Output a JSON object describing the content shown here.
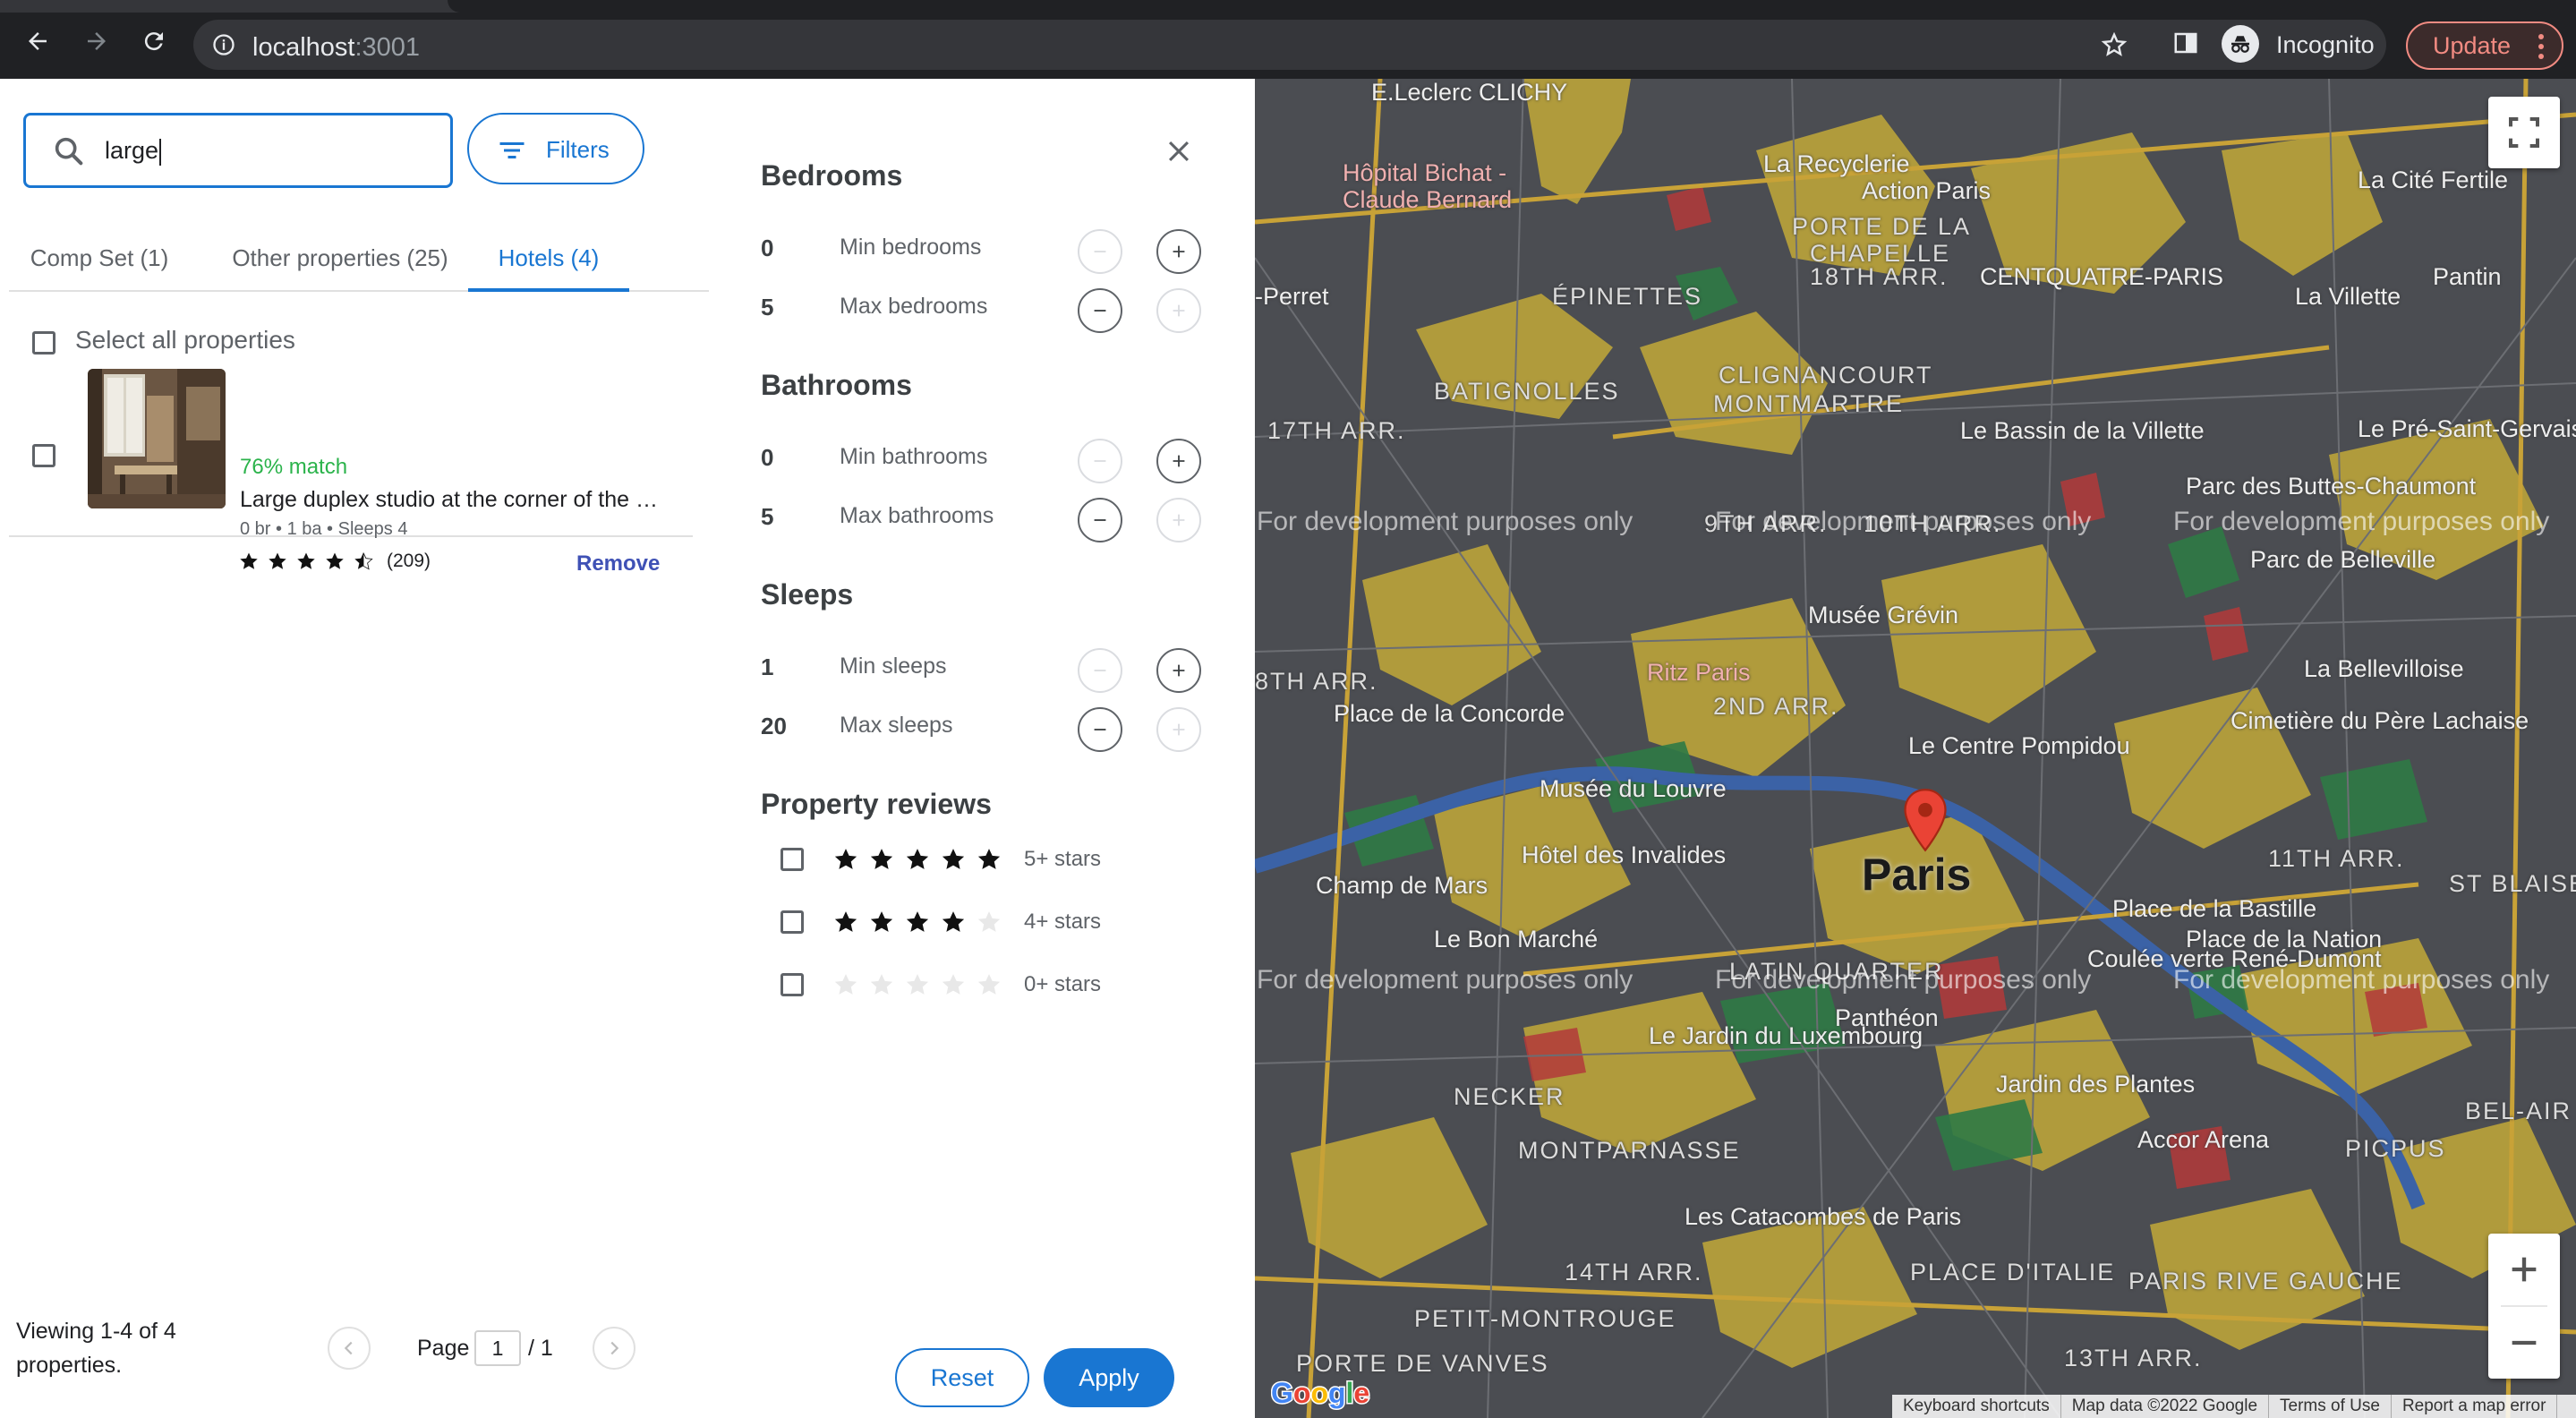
{
  "browser": {
    "url_host": "localhost",
    "url_port": ":3001",
    "profile_label": "Incognito",
    "update_label": "Update"
  },
  "search": {
    "value": "large",
    "filters_label": "Filters"
  },
  "tabs": [
    {
      "label": "Comp Set (1)",
      "active": false
    },
    {
      "label": "Other properties (25)",
      "active": false
    },
    {
      "label": "Hotels (4)",
      "active": true
    }
  ],
  "list": {
    "select_all_label": "Select all properties",
    "items": [
      {
        "match": "76% match",
        "title": "Large duplex studio at the corner of the …",
        "meta": "0 br • 1 ba • Sleeps 4",
        "rating_stars": 4.5,
        "review_count": "(209)",
        "remove_label": "Remove"
      }
    ]
  },
  "pagination": {
    "viewing_text": "Viewing 1-4 of 4 properties.",
    "page_label": "Page",
    "page_value": "1",
    "page_total": "/ 1"
  },
  "filters": {
    "bedrooms": {
      "title": "Bedrooms",
      "min_value": "0",
      "min_label": "Min bedrooms",
      "max_value": "5",
      "max_label": "Max bedrooms"
    },
    "bathrooms": {
      "title": "Bathrooms",
      "min_value": "0",
      "min_label": "Min bathrooms",
      "max_value": "5",
      "max_label": "Max bathrooms"
    },
    "sleeps": {
      "title": "Sleeps",
      "min_value": "1",
      "min_label": "Min sleeps",
      "max_value": "20",
      "max_label": "Max sleeps"
    },
    "reviews": {
      "title": "Property reviews",
      "options": [
        {
          "label": "5+ stars",
          "filled": 5
        },
        {
          "label": "4+ stars",
          "filled": 4
        },
        {
          "label": "0+ stars",
          "filled": 0
        }
      ]
    },
    "reset_label": "Reset",
    "apply_label": "Apply"
  },
  "map": {
    "city_label": "Paris",
    "dev_watermark": "For development purposes only",
    "labels": {
      "leclerc": "E.Leclerc CLICHY",
      "bichat": "Hôpital Bichat -",
      "claude": "Claude Bernard",
      "recyclerie": "La Recyclerie",
      "action": "Action Paris",
      "porte_chapelle": "PORTE DE LA",
      "chapelle": "CHAPELLE",
      "cite_fertile": "La Cité Fertile",
      "pantin": "Pantin",
      "perret": "-Perret",
      "epinettes": "ÉPINETTES",
      "arr18": "18TH ARR.",
      "centquatre": "CENTQUATRE-PARIS",
      "villette": "La Villette",
      "batignolles": "BATIGNOLLES",
      "clignancourt": "CLIGNANCOURT",
      "montmartre": "MONTMARTRE",
      "arr17": "17TH ARR.",
      "bassin": "Le Bassin de la Villette",
      "pre_st": "Le Pré-Saint-Gervais",
      "arr9": "9TH ARR.",
      "arr10": "10TH ARR.",
      "buttes": "Parc des Buttes-Chaumont",
      "belleville": "Parc de Belleville",
      "grevin": "Musée Grévin",
      "ritz": "Ritz Paris",
      "labelleville": "La Bellevilloise",
      "arr8": "8TH ARR.",
      "concorde": "Place de la Concorde",
      "arr2": "2ND ARR.",
      "pompidou": "Le Centre Pompidou",
      "pere": "Cimetière du Père Lachaise",
      "louvre": "Musée du Louvre",
      "invalides": "Hôtel des Invalides",
      "champ": "Champ de Mars",
      "arr11": "11TH ARR.",
      "stblaise": "ST BLAISE",
      "bastille": "Place de la Bastille",
      "bonmarche": "Le Bon Marché",
      "latin": "LATIN QUARTER",
      "coulee": "Coulée verte René-Dumont",
      "nation": "Place de la Nation",
      "pantheon": "Panthéon",
      "luxembourg": "Le Jardin du Luxembourg",
      "plantes": "Jardin des Plantes",
      "necker": "NECKER",
      "accor": "Accor Arena",
      "picpus": "PICPUS",
      "belair": "BEL-AIR",
      "montparnasse": "MONTPARNASSE",
      "catacombes": "Les Catacombes de Paris",
      "arr14": "14TH ARR.",
      "italie": "PLACE D'ITALIE",
      "paris_rive": "PARIS RIVE GAUCHE",
      "montrouge": "PETIT-MONTROUGE",
      "vanves": "PORTE DE VANVES",
      "arr13": "13TH ARR."
    },
    "footer": [
      "Keyboard shortcuts",
      "Map data ©2022 Google",
      "Terms of Use",
      "Report a map error"
    ]
  }
}
